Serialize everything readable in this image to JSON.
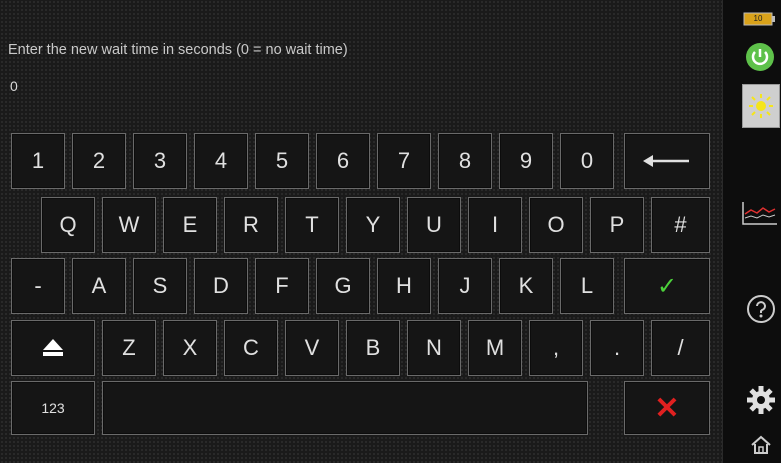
{
  "prompt": "Enter the new wait time in seconds (0 = no wait time)",
  "input_value": "0",
  "keyboard": {
    "row1": [
      "1",
      "2",
      "3",
      "4",
      "5",
      "6",
      "7",
      "8",
      "9",
      "0"
    ],
    "row2": [
      "Q",
      "W",
      "E",
      "R",
      "T",
      "Y",
      "U",
      "I",
      "O",
      "P",
      "#"
    ],
    "row3": [
      "-",
      "A",
      "S",
      "D",
      "F",
      "G",
      "H",
      "J",
      "K",
      "L"
    ],
    "row4": [
      "Z",
      "X",
      "C",
      "V",
      "B",
      "N",
      "M",
      ",",
      ".",
      "/"
    ],
    "mode_label": "123"
  },
  "status": {
    "battery_label": "10"
  },
  "colors": {
    "confirm": "#4cd13b",
    "cancel": "#e02020",
    "power": "#5ec14a",
    "brightness": "#f5e51a"
  },
  "icons": [
    "backspace-icon",
    "check-icon",
    "shift-icon",
    "close-icon",
    "battery-icon",
    "power-icon",
    "brightness-icon",
    "trend-chart-icon",
    "help-icon",
    "gear-icon",
    "home-icon"
  ]
}
